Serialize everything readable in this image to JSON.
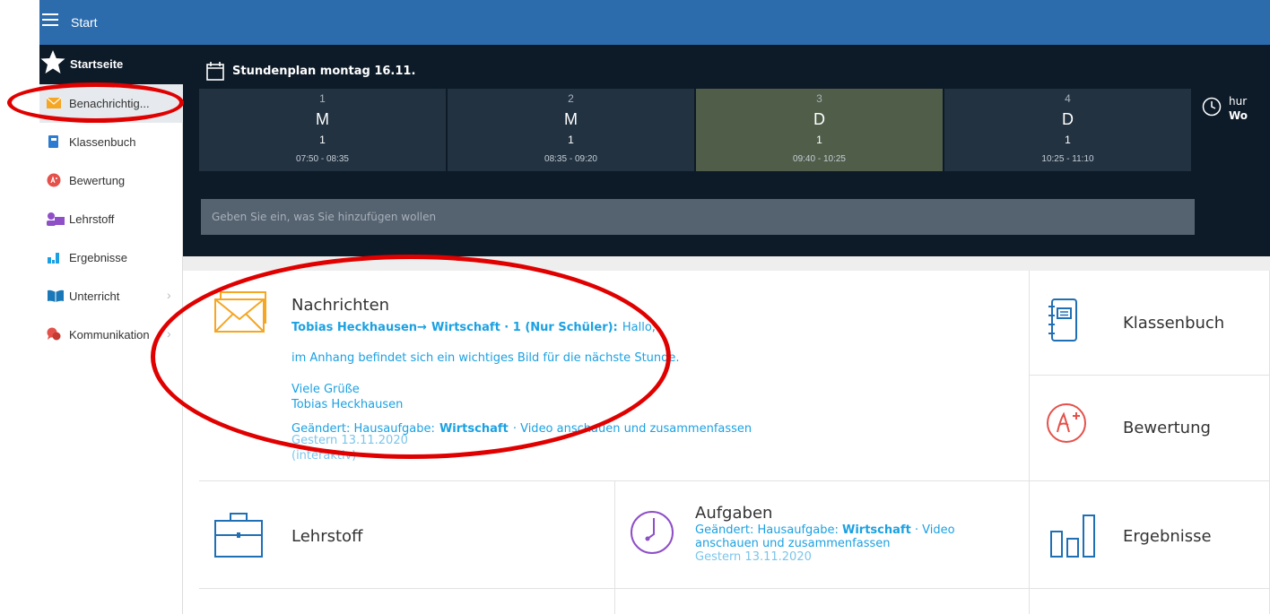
{
  "topbar": {
    "title": "Start"
  },
  "sidebar": {
    "header_label": "Startseite",
    "items": [
      {
        "label": "Benachrichtig...",
        "icon": "envelope-icon"
      },
      {
        "label": "Klassenbuch",
        "icon": "book-icon"
      },
      {
        "label": "Bewertung",
        "icon": "grade-icon"
      },
      {
        "label": "Lehrstoff",
        "icon": "teacher-icon"
      },
      {
        "label": "Ergebnisse",
        "icon": "bar-chart-icon"
      },
      {
        "label": "Unterricht",
        "icon": "open-book-icon"
      },
      {
        "label": "Kommunikation",
        "icon": "chat-icon"
      }
    ]
  },
  "schedule": {
    "title": "Stundenplan montag 16.11.",
    "periods": [
      {
        "number": "1",
        "subject": "M",
        "room": "1",
        "time": "07:50 - 08:35",
        "current": false
      },
      {
        "number": "2",
        "subject": "M",
        "room": "1",
        "time": "08:35 - 09:20",
        "current": false
      },
      {
        "number": "3",
        "subject": "D",
        "room": "1",
        "time": "09:40 - 10:25",
        "current": true
      },
      {
        "number": "4",
        "subject": "D",
        "room": "1",
        "time": "10:25 - 11:10",
        "current": false
      }
    ],
    "side_text_line1": "hur",
    "side_text_line2": "Wo",
    "add_placeholder": "Geben Sie ein, was Sie hinzufügen wollen"
  },
  "nachrichten": {
    "title": "Nachrichten",
    "sender": "Tobias Heckhausen",
    "arrow": "→",
    "recipient": "Wirtschaft · 1 (Nur Schüler):",
    "greeting": "Hallo,",
    "body": "im Anhang befindet sich ein wichtiges Bild für die nächste Stunde.",
    "closing": "Viele Grüße",
    "signature": "Tobias Heckhausen",
    "changed_prefix": "Geändert: Hausaufgabe:",
    "changed_subject": "Wirtschaft",
    "changed_suffix": "· Video anschauen und zusammenfassen",
    "date": "Gestern 13.11.2020",
    "mode": "(interaktiv)"
  },
  "tiles": {
    "klassenbuch": "Klassenbuch",
    "bewertung": "Bewertung",
    "lehrstoff": "Lehrstoff",
    "ergebnisse": "Ergebnisse"
  },
  "aufgaben": {
    "title": "Aufgaben",
    "changed_prefix": "Geändert: Hausaufgabe:",
    "subject": "Wirtschaft",
    "suffix_line1": "· Video",
    "suffix_line2": "anschauen und zusammenfassen",
    "date": "Gestern 13.11.2020"
  },
  "colors": {
    "topbar": "#2c6cad",
    "schedule_bg": "#0d1b28",
    "period_bg": "#223241",
    "current_period_bg": "#4f5d49",
    "link_blue": "#1ba1e2",
    "annotation_red": "#e00000"
  }
}
